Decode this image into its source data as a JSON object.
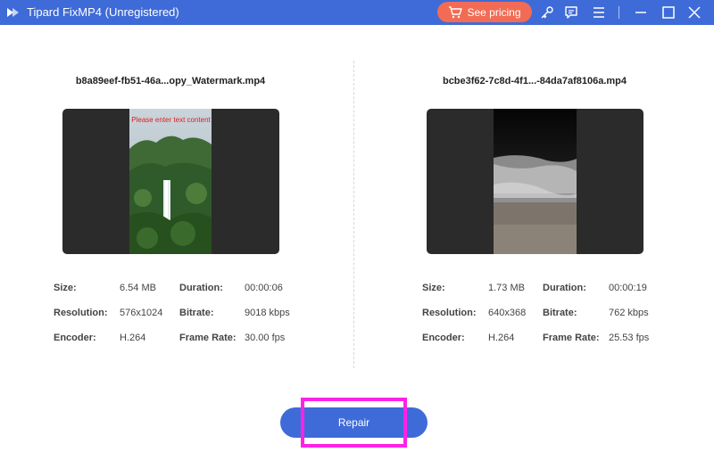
{
  "app": {
    "title": "Tipard FixMP4 (Unregistered)",
    "accent_color": "#3f6bd8",
    "pricing_color": "#f26b54",
    "highlight_color": "#ff22e6"
  },
  "titlebar": {
    "pricing_label": "See pricing",
    "icons": [
      "cart-icon",
      "key-icon",
      "feedback-icon",
      "menu-icon",
      "minimize-icon",
      "maximize-icon",
      "close-icon"
    ]
  },
  "left": {
    "file_name": "b8a89eef-fb51-46a...opy_Watermark.mp4",
    "overlay_text": "Please enter text content",
    "size_label": "Size:",
    "size_value": "6.54 MB",
    "duration_label": "Duration:",
    "duration_value": "00:00:06",
    "resolution_label": "Resolution:",
    "resolution_value": "576x1024",
    "bitrate_label": "Bitrate:",
    "bitrate_value": "9018 kbps",
    "encoder_label": "Encoder:",
    "encoder_value": "H.264",
    "framerate_label": "Frame Rate:",
    "framerate_value": "30.00 fps"
  },
  "right": {
    "file_name": "bcbe3f62-7c8d-4f1...-84da7af8106a.mp4",
    "size_label": "Size:",
    "size_value": "1.73 MB",
    "duration_label": "Duration:",
    "duration_value": "00:00:19",
    "resolution_label": "Resolution:",
    "resolution_value": "640x368",
    "bitrate_label": "Bitrate:",
    "bitrate_value": "762 kbps",
    "encoder_label": "Encoder:",
    "encoder_value": "H.264",
    "framerate_label": "Frame Rate:",
    "framerate_value": "25.53 fps"
  },
  "repair": {
    "label": "Repair"
  }
}
